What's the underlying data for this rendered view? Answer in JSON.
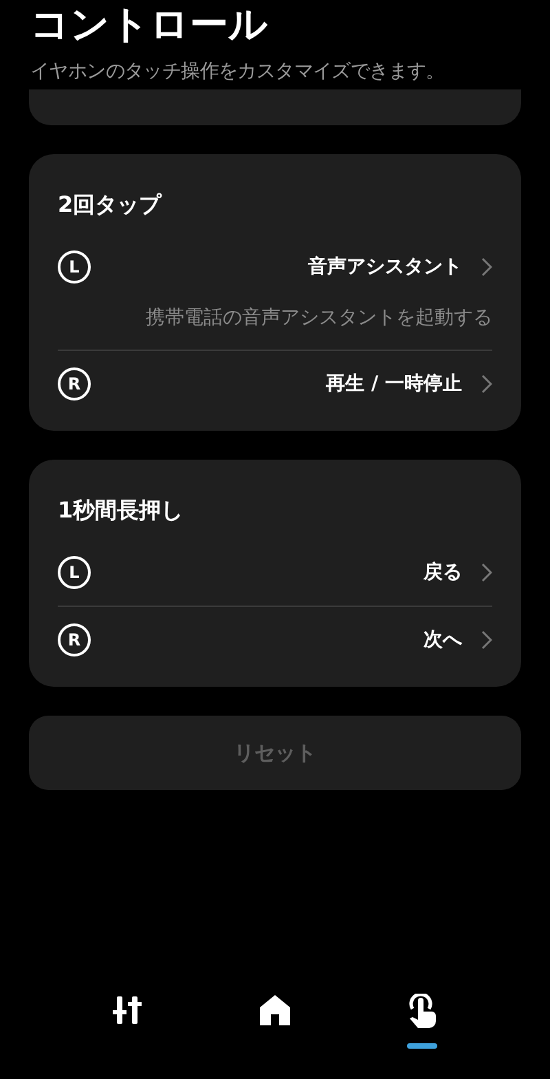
{
  "header": {
    "title": "コントロール",
    "subtitle": "イヤホンのタッチ操作をカスタマイズできます。"
  },
  "sections": [
    {
      "title": "2回タップ",
      "rows": [
        {
          "side": "L",
          "value": "音声アシスタント",
          "description": "携帯電話の音声アシスタントを起動する"
        },
        {
          "side": "R",
          "value": "再生 / 一時停止"
        }
      ]
    },
    {
      "title": "1秒間長押し",
      "rows": [
        {
          "side": "L",
          "value": "戻る"
        },
        {
          "side": "R",
          "value": "次へ"
        }
      ]
    }
  ],
  "reset_button": {
    "label": "リセット",
    "disabled": true
  },
  "bottom_nav": [
    {
      "kind": "equalizer",
      "selected": false
    },
    {
      "kind": "home",
      "selected": false
    },
    {
      "kind": "touch",
      "selected": true
    }
  ]
}
